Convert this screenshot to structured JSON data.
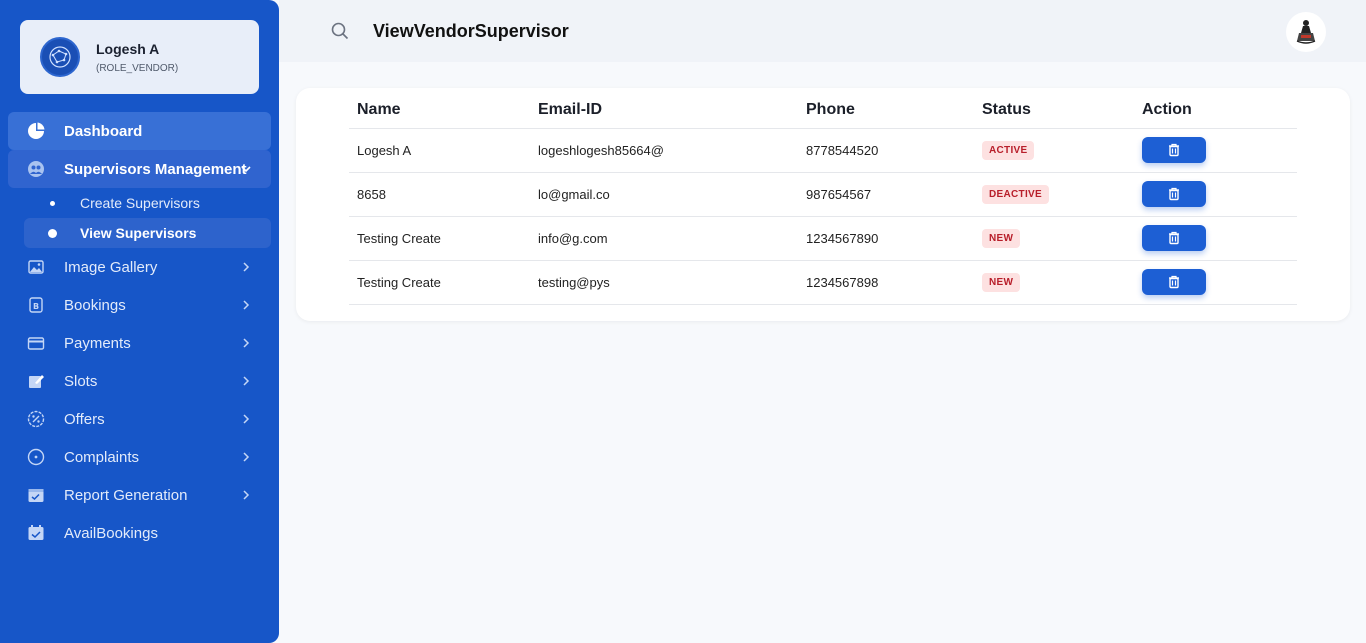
{
  "profile": {
    "name": "Logesh A",
    "role": "(ROLE_VENDOR)"
  },
  "sidebar": {
    "items": [
      {
        "label": "Dashboard"
      },
      {
        "label": "Supervisors Management"
      },
      {
        "label": "Image Gallery"
      },
      {
        "label": "Bookings"
      },
      {
        "label": "Payments"
      },
      {
        "label": "Slots"
      },
      {
        "label": "Offers"
      },
      {
        "label": "Complaints"
      },
      {
        "label": "Report Generation"
      },
      {
        "label": "AvailBookings"
      }
    ],
    "sub_items": [
      {
        "label": "Create Supervisors"
      },
      {
        "label": "View Supervisors"
      }
    ]
  },
  "header": {
    "title": "ViewVendorSupervisor"
  },
  "table": {
    "columns": [
      "Name",
      "Email-ID",
      "Phone",
      "Status",
      "Action"
    ],
    "rows": [
      {
        "name": "Logesh A",
        "email": "logeshlogesh85664@",
        "phone": "8778544520",
        "status": "ACTIVE"
      },
      {
        "name": "8658",
        "email": "lo@gmail.co",
        "phone": "987654567",
        "status": "DEACTIVE"
      },
      {
        "name": "Testing Create",
        "email": "info@g.com",
        "phone": "1234567890",
        "status": "NEW"
      },
      {
        "name": "Testing Create",
        "email": "testing@pys",
        "phone": "1234567898",
        "status": "NEW"
      }
    ]
  },
  "colors": {
    "sidebar": "#1756c8",
    "button": "#1d5fd4",
    "badge_bg": "#fde1e1",
    "badge_text": "#b81e2a"
  }
}
